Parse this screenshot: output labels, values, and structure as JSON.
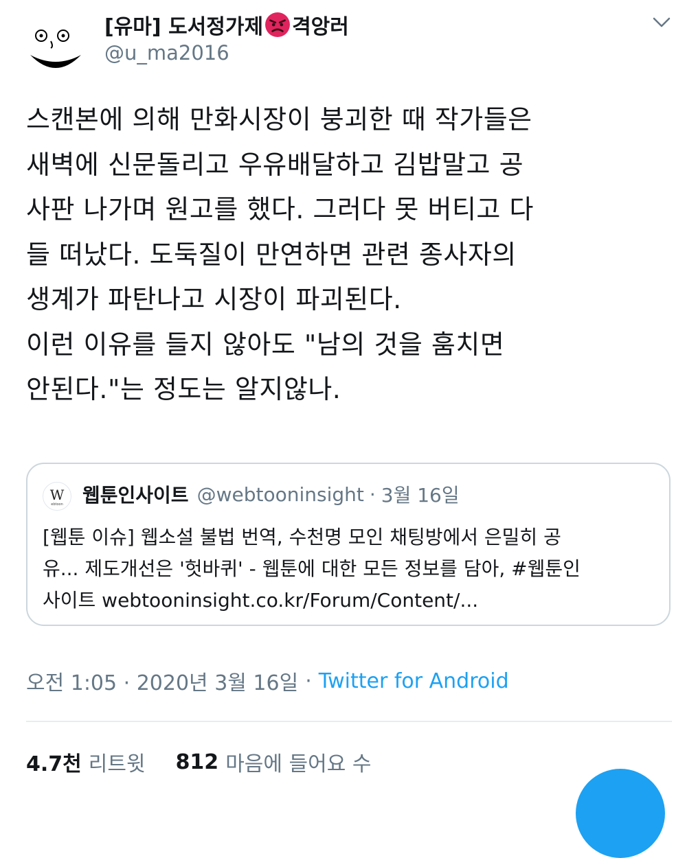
{
  "author": {
    "display_name_prefix": "[유마] 도서정가제",
    "display_name_suffix": "격앙러",
    "name_emoji": "angry-face-emoji",
    "handle": "@u_ma2016"
  },
  "menu_icon": "chevron-down-icon",
  "tweet": {
    "lines": [
      "스캔본에 의해 만화시장이 붕괴한 때 작가들은",
      "새벽에 신문돌리고 우유배달하고 김밥말고 공",
      "사판 나가며 원고를 했다. 그러다 못 버티고 다",
      "들 떠났다. 도둑질이 만연하면 관련 종사자의",
      "생계가 파탄나고 시장이 파괴된다.",
      "이런 이유를 들지 않아도  \"남의 것을 훔치면",
      "안된다.\"는 정도는 알지않나."
    ]
  },
  "quoted_tweet": {
    "name": "웹툰인사이트",
    "handle": "@webtooninsight",
    "separator": "·",
    "date": "3월 16일",
    "lines": [
      "[웹툰 이슈] 웹소설 불법 번역, 수천명 모인 채팅방에서 은밀히 공",
      "유... 제도개선은 '헛바퀴' - 웹툰에 대한 모든 정보를 담아, #웹툰인",
      "사이트 webtooninsight.co.kr/Forum/Content/..."
    ]
  },
  "meta": {
    "time_date": "오전 1:05 · 2020년 3월 16일",
    "separator": "·",
    "source": "Twitter for Android"
  },
  "stats": {
    "retweets_count": "4.7천",
    "retweets_label": "리트윗",
    "likes_count": "812",
    "likes_label": "마음에 들어요 수"
  },
  "colors": {
    "accent": "#1da1f2",
    "text": "#14171a",
    "secondary": "#657786",
    "border": "#ccd6dd"
  }
}
